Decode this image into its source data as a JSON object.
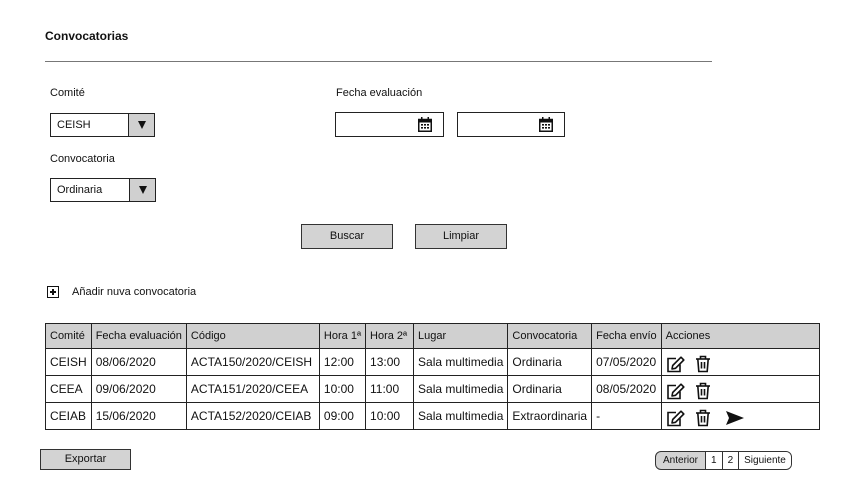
{
  "page": {
    "title": "Convocatorias"
  },
  "filters": {
    "comite_label": "Comité",
    "comite_value": "CEISH",
    "fecha_label": "Fecha evaluación",
    "fecha_desde": "",
    "fecha_hasta": "",
    "convocatoria_label": "Convocatoria",
    "convocatoria_value": "Ordinaria"
  },
  "actions": {
    "buscar": "Buscar",
    "limpiar": "Limpiar",
    "add_new": "Añadir nuva convocatoria",
    "exportar": "Exportar"
  },
  "table": {
    "headers": [
      "Comité",
      "Fecha evaluación",
      "Código",
      "Hora 1ª",
      "Hora 2ª",
      "Lugar",
      "Convocatoria",
      "Fecha envío",
      "Acciones"
    ],
    "rows": [
      {
        "comite": "CEISH",
        "fecha": "08/06/2020",
        "codigo": "ACTA150/2020/CEISH",
        "hora1": "12:00",
        "hora2": "13:00",
        "lugar": "Sala multimedia",
        "convocatoria": "Ordinaria",
        "envio": "07/05/2020",
        "icons": [
          "edit-icon",
          "trash-icon"
        ]
      },
      {
        "comite": "CEEA",
        "fecha": "09/06/2020",
        "codigo": "ACTA151/2020/CEEA",
        "hora1": "10:00",
        "hora2": "11:00",
        "lugar": "Sala multimedia",
        "convocatoria": "Ordinaria",
        "envio": "08/05/2020",
        "icons": [
          "edit-icon",
          "trash-icon"
        ]
      },
      {
        "comite": "CEIAB",
        "fecha": "15/06/2020",
        "codigo": "ACTA152/2020/CEIAB",
        "hora1": "09:00",
        "hora2": "10:00",
        "lugar": "Sala multimedia",
        "convocatoria": "Extraordinaria",
        "envio": "-",
        "icons": [
          "edit-icon",
          "trash-icon",
          "send-icon"
        ]
      }
    ]
  },
  "pagination": {
    "prev": "Anterior",
    "pages": [
      "1",
      "2"
    ],
    "next": "Siguiente"
  }
}
